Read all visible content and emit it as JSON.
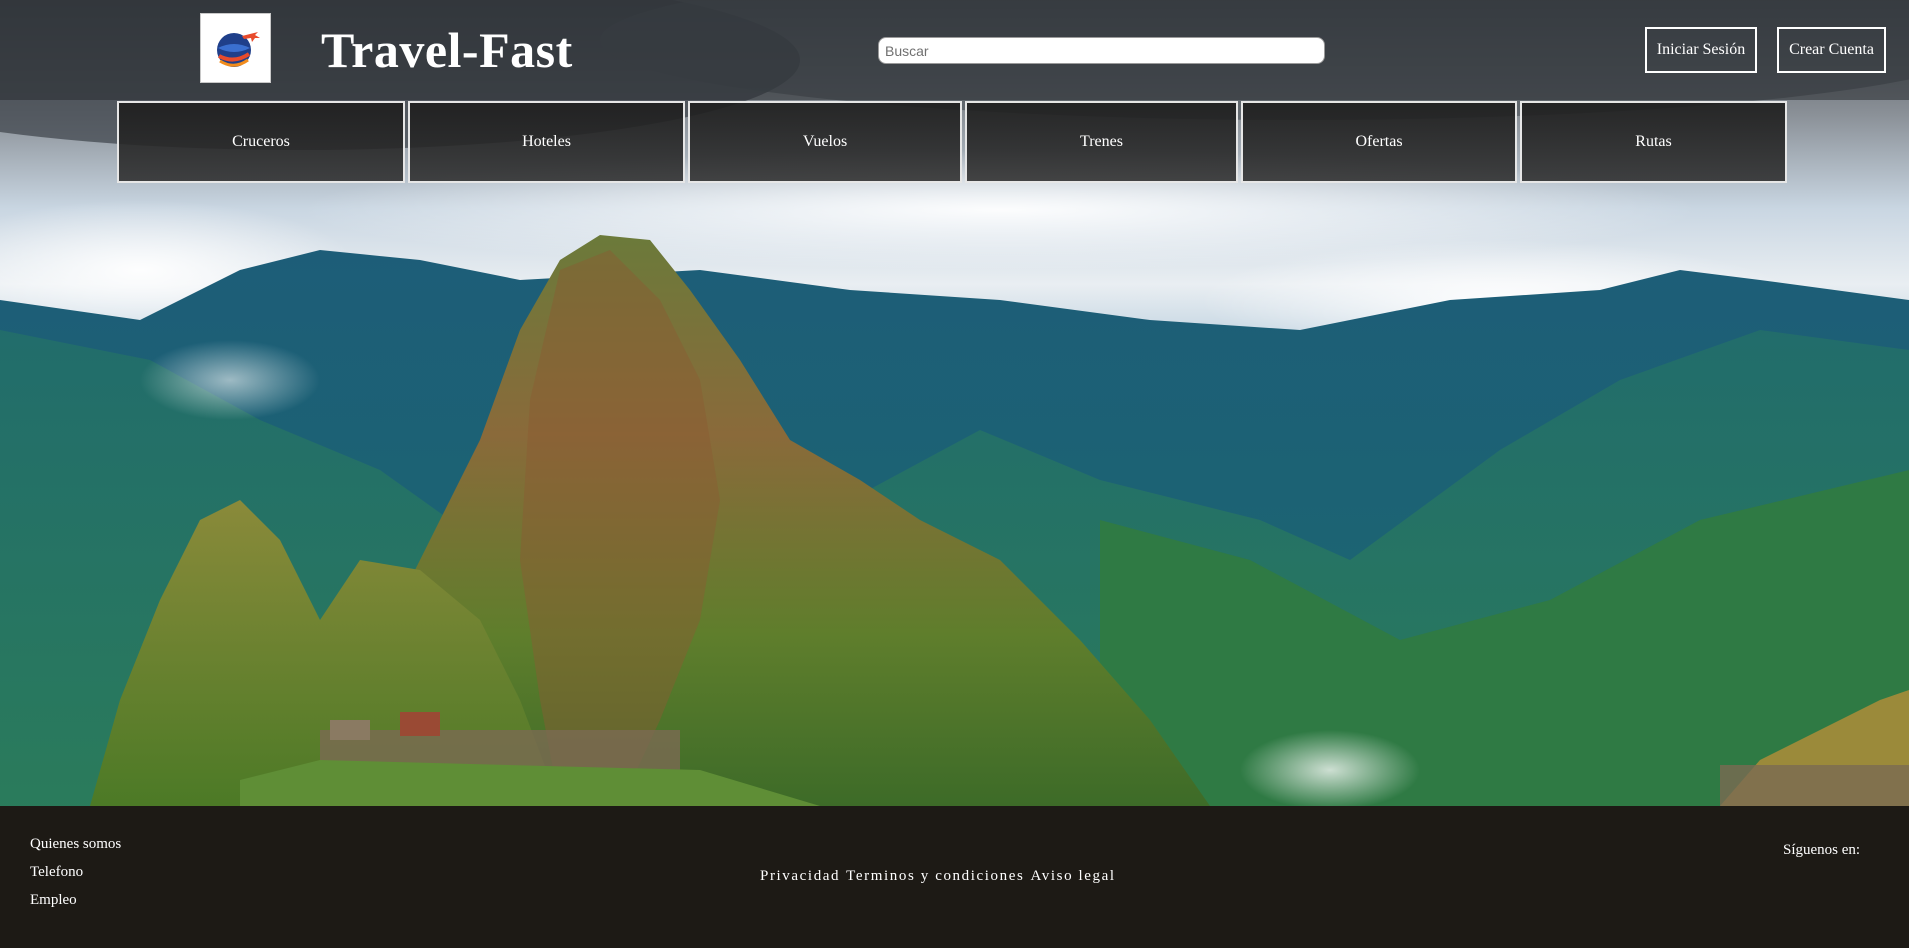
{
  "header": {
    "brand": "Travel-Fast",
    "search_placeholder": "Buscar",
    "login_label": "Iniciar Sesión",
    "signup_label": "Crear Cuenta"
  },
  "nav": {
    "items": [
      {
        "label": "Cruceros"
      },
      {
        "label": "Hoteles"
      },
      {
        "label": "Vuelos"
      },
      {
        "label": "Trenes"
      },
      {
        "label": "Ofertas"
      },
      {
        "label": "Rutas"
      }
    ]
  },
  "footer": {
    "links": [
      {
        "label": "Quienes somos"
      },
      {
        "label": "Telefono"
      },
      {
        "label": "Empleo"
      }
    ],
    "legal": {
      "privacy": "Privacidad",
      "terms": "Terminos y condiciones",
      "notice": "Aviso legal"
    },
    "follow_label": "Síguenos en:"
  },
  "icons": {
    "logo": "globe-airplane-icon"
  },
  "colors": {
    "nav_background": "#2b2b2b",
    "footer_background": "#1a1714",
    "text": "#ffffff"
  }
}
